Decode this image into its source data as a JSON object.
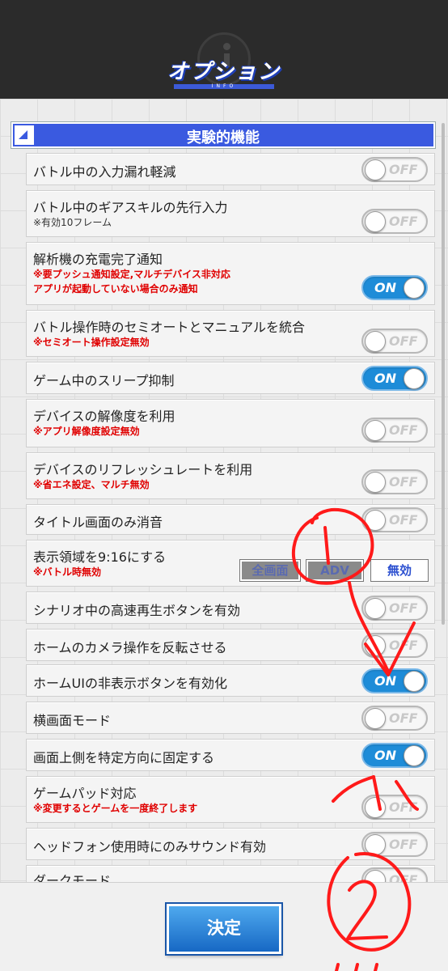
{
  "header": {
    "title": "オプション",
    "subtitle": "INFO"
  },
  "section": {
    "title": "実験的機能"
  },
  "settings": [
    {
      "label": "バトル中の入力漏れ軽減",
      "note": "",
      "note2": "",
      "state": "OFF"
    },
    {
      "label": "バトル中のギアスキルの先行入力",
      "note": "※有効10フレーム",
      "note2": "",
      "state": "OFF"
    },
    {
      "label": "解析機の充電完了通知",
      "note": "※要プッシュ通知設定,マルチデバイス非対応",
      "note2": "アプリが起動していない場合のみ通知",
      "state": "ON"
    },
    {
      "label": "バトル操作時のセミオートとマニュアルを統合",
      "note": "※セミオート操作設定無効",
      "note2": "",
      "state": "OFF"
    },
    {
      "label": "ゲーム中のスリープ抑制",
      "note": "",
      "note2": "",
      "state": "ON"
    },
    {
      "label": "デバイスの解像度を利用",
      "note": "※アプリ解像度設定無効",
      "note2": "",
      "state": "OFF"
    },
    {
      "label": "デバイスのリフレッシュレートを利用",
      "note": "※省エネ設定、マルチ無効",
      "note2": "",
      "state": "OFF"
    },
    {
      "label": "タイトル画面のみ消音",
      "note": "",
      "note2": "",
      "state": "OFF"
    },
    {
      "label": "表示領域を9:16にする",
      "note": "※バトル時無効",
      "note2": "",
      "options": [
        "全画面",
        "ADV",
        "無効"
      ],
      "selected": "無効"
    },
    {
      "label": "シナリオ中の高速再生ボタンを有効",
      "note": "",
      "note2": "",
      "state": "OFF"
    },
    {
      "label": "ホームのカメラ操作を反転させる",
      "note": "",
      "note2": "",
      "state": "OFF"
    },
    {
      "label": "ホームUIの非表示ボタンを有効化",
      "note": "",
      "note2": "",
      "state": "ON"
    },
    {
      "label": "横画面モード",
      "note": "",
      "note2": "",
      "state": "OFF"
    },
    {
      "label": "画面上側を特定方向に固定する",
      "note": "",
      "note2": "",
      "state": "ON"
    },
    {
      "label": "ゲームパッド対応",
      "note": "※変更するとゲームを一度終了します",
      "note2": "",
      "state": "OFF"
    },
    {
      "label": "ヘッドフォン使用時にのみサウンド有効",
      "note": "",
      "note2": "",
      "state": "OFF"
    },
    {
      "label": "ダークモード",
      "note": "",
      "note2": "",
      "state": "OFF"
    }
  ],
  "footer": {
    "confirm_label": "決定"
  },
  "annotation": {
    "marks": [
      "①",
      "②"
    ],
    "color": "#ff1a1a"
  },
  "colors": {
    "accent": "#3a5ae0",
    "toggle_on": "#1e8cd8",
    "note_red": "#e00000",
    "header_bg": "#2b2b2b"
  }
}
